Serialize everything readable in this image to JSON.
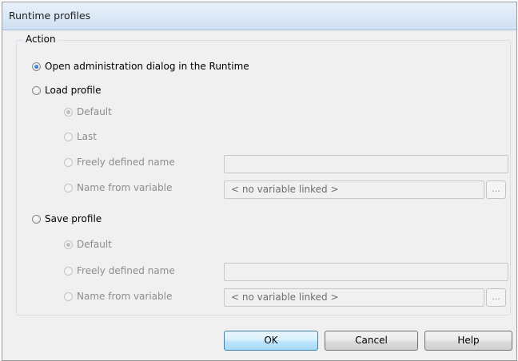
{
  "window": {
    "title": "Runtime profiles"
  },
  "group": {
    "label": "Action"
  },
  "options": {
    "open_admin": "Open administration dialog in the Runtime",
    "load_profile": {
      "label": "Load profile",
      "default": "Default",
      "last": "Last",
      "freely_defined": "Freely defined name",
      "freely_defined_value": "",
      "from_variable": "Name from variable",
      "variable_value": "< no variable linked >",
      "browse_label": "..."
    },
    "save_profile": {
      "label": "Save profile",
      "default": "Default",
      "freely_defined": "Freely defined name",
      "freely_defined_value": "",
      "from_variable": "Name from variable",
      "variable_value": "< no variable linked >",
      "browse_label": "..."
    }
  },
  "buttons": {
    "ok": "OK",
    "cancel": "Cancel",
    "help": "Help"
  }
}
